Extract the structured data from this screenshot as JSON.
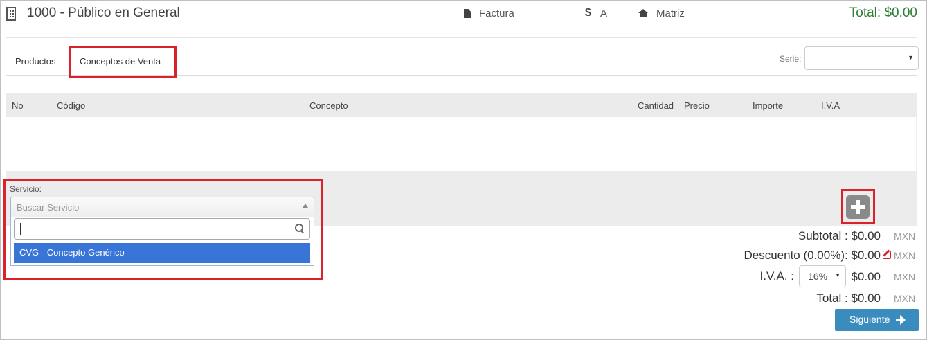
{
  "header": {
    "client": "1000 - Público en General",
    "client_icon": "building-icon",
    "document_type": "Factura",
    "document_icon": "file-icon",
    "currency_symbol": "$",
    "currency": "A",
    "branch_icon": "home-icon",
    "branch": "Matriz",
    "total": "Total: $0.00"
  },
  "tabs": [
    {
      "label": "Productos"
    },
    {
      "label": "Conceptos de Venta"
    }
  ],
  "serie": {
    "label": "Serie:",
    "value": ""
  },
  "table": {
    "columns": [
      "No",
      "Código",
      "Concepto",
      "Cantidad",
      "Precio",
      "Importe",
      "I.V.A"
    ],
    "rows": []
  },
  "servicio": {
    "label": "Servicio:",
    "placeholder": "Buscar Servicio",
    "search_value": "",
    "options": [
      "CVG - Concepto Genérico"
    ]
  },
  "totals": {
    "subtotal_label": "Subtotal :",
    "subtotal": "$0.00",
    "descuento_label": "Descuento (0.00%):",
    "descuento": "$0.00",
    "iva_label": "I.V.A. :",
    "iva_rate": "16%",
    "iva": "$0.00",
    "total_label": "Total :",
    "total": "$0.00",
    "currency": "MXN"
  },
  "actions": {
    "next_label": "Siguiente"
  },
  "colors": {
    "total_green": "#2e7d32",
    "highlight_red": "#d9222a",
    "option_blue": "#3875d7",
    "next_blue": "#3a8cbf"
  }
}
